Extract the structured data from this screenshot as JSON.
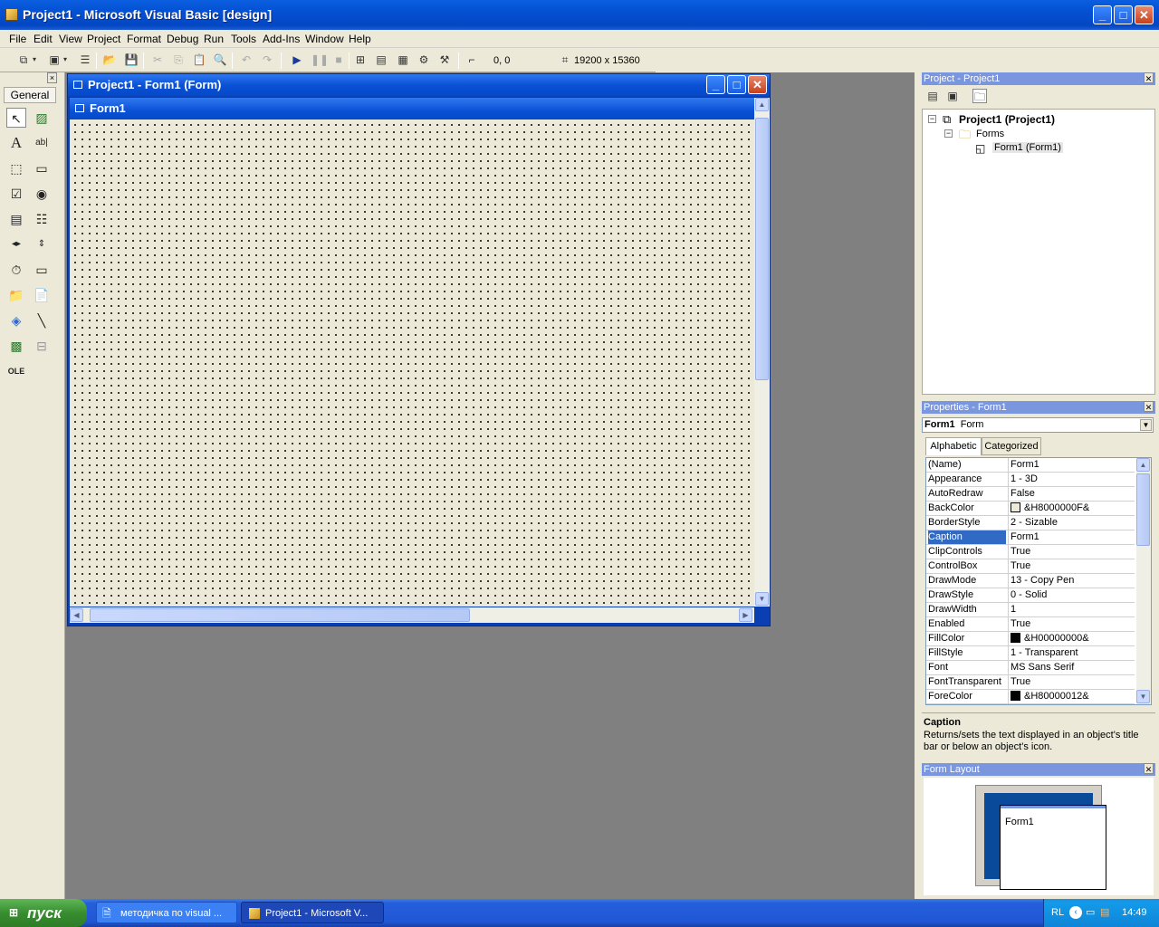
{
  "window": {
    "title": "Project1 - Microsoft Visual Basic [design]"
  },
  "menu": [
    "File",
    "Edit",
    "View",
    "Project",
    "Format",
    "Debug",
    "Run",
    "Tools",
    "Add-Ins",
    "Window",
    "Help"
  ],
  "toolbar": {
    "position": "0, 0",
    "size": "19200 x 15360"
  },
  "toolbox": {
    "tab": "General",
    "close": "×"
  },
  "form_window": {
    "title": "Project1 - Form1 (Form)",
    "form_caption": "Form1"
  },
  "project_panel": {
    "title": "Project - Project1",
    "tree": {
      "root": "Project1 (Project1)",
      "folder": "Forms",
      "item": "Form1 (Form1)"
    }
  },
  "properties_panel": {
    "title": "Properties - Form1",
    "object_name": "Form1",
    "object_type": "Form",
    "tabs": [
      "Alphabetic",
      "Categorized"
    ],
    "rows": [
      {
        "name": "(Name)",
        "value": "Form1"
      },
      {
        "name": "Appearance",
        "value": "1 - 3D"
      },
      {
        "name": "AutoRedraw",
        "value": "False"
      },
      {
        "name": "BackColor",
        "value": "&H8000000F&",
        "swatch": "#ece9d8"
      },
      {
        "name": "BorderStyle",
        "value": "2 - Sizable"
      },
      {
        "name": "Caption",
        "value": "Form1",
        "selected": true
      },
      {
        "name": "ClipControls",
        "value": "True"
      },
      {
        "name": "ControlBox",
        "value": "True"
      },
      {
        "name": "DrawMode",
        "value": "13 - Copy Pen"
      },
      {
        "name": "DrawStyle",
        "value": "0 - Solid"
      },
      {
        "name": "DrawWidth",
        "value": "1"
      },
      {
        "name": "Enabled",
        "value": "True"
      },
      {
        "name": "FillColor",
        "value": "&H00000000&",
        "swatch": "#000000"
      },
      {
        "name": "FillStyle",
        "value": "1 - Transparent"
      },
      {
        "name": "Font",
        "value": "MS Sans Serif"
      },
      {
        "name": "FontTransparent",
        "value": "True"
      },
      {
        "name": "ForeColor",
        "value": "&H80000012&",
        "swatch": "#000000"
      }
    ],
    "description_title": "Caption",
    "description_text": "Returns/sets the text displayed in an object's title bar or below an object's icon."
  },
  "layout_panel": {
    "title": "Form Layout",
    "form_label": "Form1"
  },
  "taskbar": {
    "start": "пуск",
    "items": [
      "методичка по visual ...",
      "Project1 - Microsoft V..."
    ],
    "lang": "RL",
    "time": "14:49"
  },
  "colors": {
    "title_blue": "#0450d2",
    "selection": "#316ac5",
    "taskbar": "#245edb",
    "start_green": "#388d2f"
  }
}
